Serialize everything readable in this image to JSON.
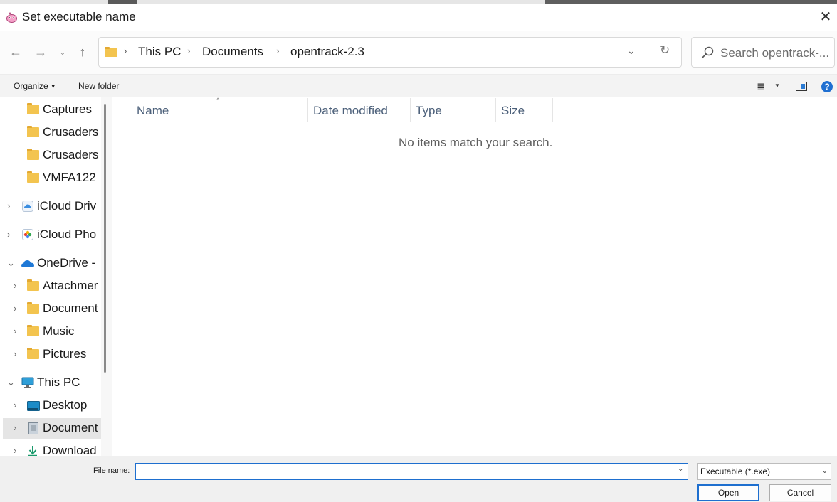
{
  "window": {
    "title": "Set executable name",
    "close_glyph": "✕"
  },
  "nav": {
    "back_glyph": "←",
    "forward_glyph": "→",
    "recent_glyph": "⌄",
    "up_glyph": "↑",
    "breadcrumb": [
      "This PC",
      "Documents",
      "opentrack-2.3"
    ],
    "separator": "›",
    "dropdown_glyph": "⌄",
    "refresh_glyph": "↻",
    "search_placeholder": "Search opentrack-..."
  },
  "commandbar": {
    "organize_label": "Organize",
    "new_folder_label": "New folder",
    "view_glyph": "≣",
    "help_glyph": "?"
  },
  "sidebar": {
    "items": [
      {
        "label": "Captures",
        "icon": "folder-icon",
        "chevron": ""
      },
      {
        "label": "Crusaders",
        "icon": "folder-icon",
        "chevron": ""
      },
      {
        "label": "Crusaders",
        "icon": "folder-icon",
        "chevron": ""
      },
      {
        "label": "VMFA122",
        "icon": "folder-icon",
        "chevron": ""
      },
      {
        "label": "iCloud Driv",
        "icon": "icloud-drive-icon",
        "chevron": "›"
      },
      {
        "label": "iCloud Pho",
        "icon": "icloud-photos-icon",
        "chevron": "›"
      },
      {
        "label": "OneDrive -",
        "icon": "onedrive-icon",
        "chevron": "⌄"
      },
      {
        "label": "Attachmer",
        "icon": "folder-icon",
        "chevron": "›"
      },
      {
        "label": "Document",
        "icon": "folder-icon",
        "chevron": "›"
      },
      {
        "label": "Music",
        "icon": "folder-icon",
        "chevron": "›"
      },
      {
        "label": "Pictures",
        "icon": "folder-icon",
        "chevron": "›"
      },
      {
        "label": "This PC",
        "icon": "this-pc-icon",
        "chevron": "⌄"
      },
      {
        "label": "Desktop",
        "icon": "desktop-icon",
        "chevron": "›"
      },
      {
        "label": "Document",
        "icon": "documents-icon",
        "chevron": "›"
      },
      {
        "label": "Download",
        "icon": "downloads-icon",
        "chevron": "›"
      }
    ]
  },
  "filelist": {
    "columns": [
      "Name",
      "Date modified",
      "Type",
      "Size"
    ],
    "sort_glyph": "^",
    "empty_message": "No items match your search."
  },
  "footer": {
    "file_name_label": "File name:",
    "file_name_value": "",
    "file_type_value": "Executable (*.exe)",
    "dropdown_glyph": "⌄",
    "open_label": "Open",
    "cancel_label": "Cancel"
  },
  "colors": {
    "accent": "#1e6fcf",
    "folder": "#f3c44f",
    "header_text": "#4c607a"
  }
}
